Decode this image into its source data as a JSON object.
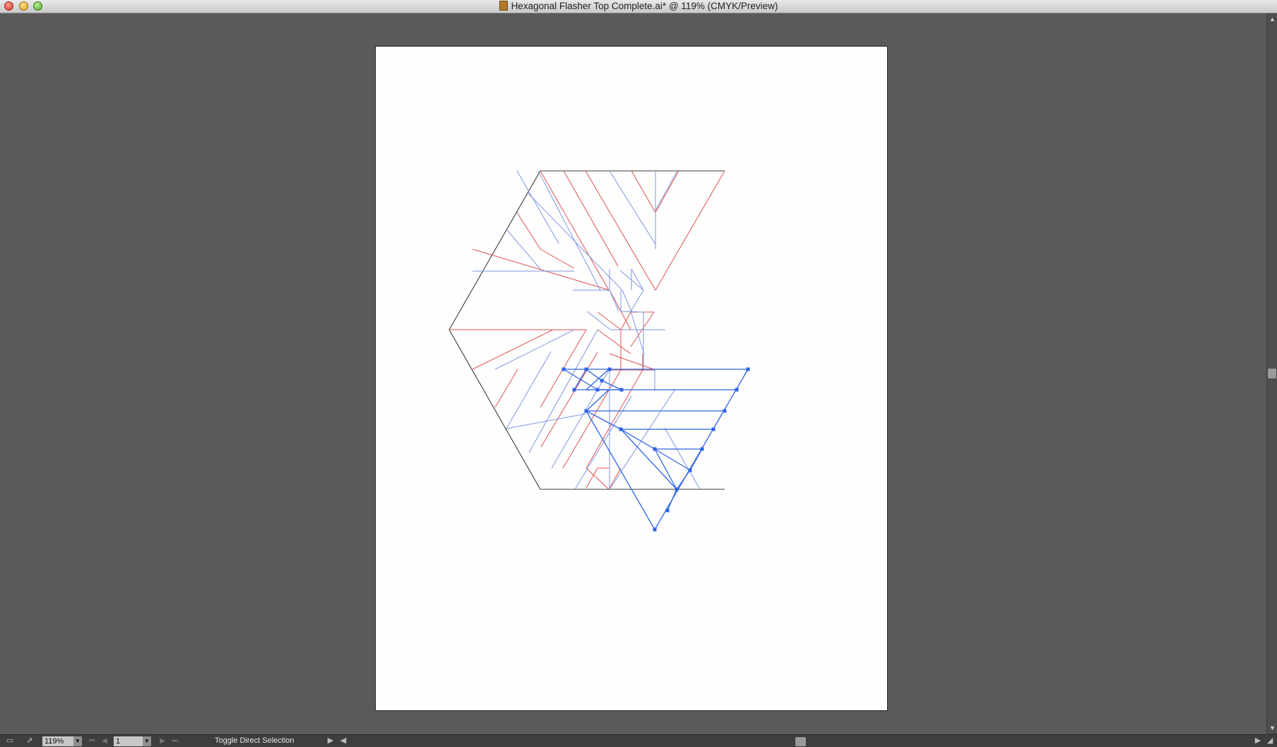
{
  "window": {
    "title": "Hexagonal Flasher Top Complete.ai* @ 119% (CMYK/Preview)",
    "buttons": {
      "close": "close-button",
      "minimize": "minimize-button",
      "zoom": "zoom-button"
    }
  },
  "artwork": {
    "colors": {
      "mountain_fold": "#e05050",
      "valley_fold": "#7f96e6",
      "selection": "#2f64e8",
      "outline": "#3a3a3a",
      "artboard": "#fdfefd",
      "pasteboard": "#5a5a5a"
    }
  },
  "statusbar": {
    "zoom": "119%",
    "artboard_number": "1",
    "status_label": "Toggle Direct Selection",
    "icons": {
      "left": "artboard-options-icon",
      "share": "share-icon",
      "first": "first-artboard-icon",
      "prev": "previous-artboard-icon",
      "next": "next-artboard-icon",
      "last": "last-artboard-icon",
      "zoom_dropdown": "chevron-down-icon",
      "artboard_dropdown": "chevron-down-icon",
      "status_menu": "triangle-right-icon"
    }
  }
}
